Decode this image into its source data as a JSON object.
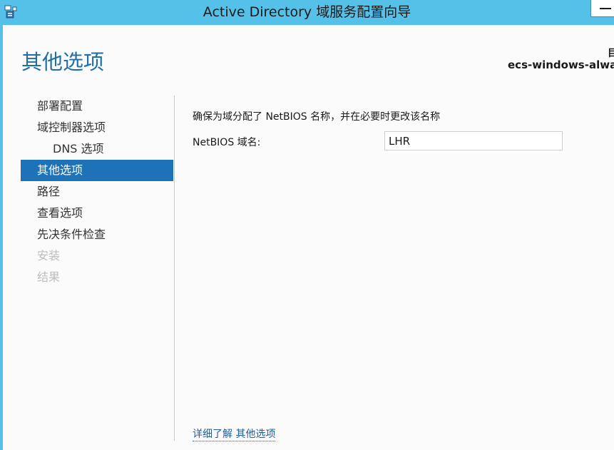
{
  "window": {
    "title": "Active Directory 域服务配置向导",
    "icon": "server-manager-icon"
  },
  "header": {
    "page_title": "其他选项",
    "target_server_label": "目",
    "target_server_name": "ecs-windows-always"
  },
  "nav": {
    "items": [
      {
        "label": "部署配置",
        "state": "normal"
      },
      {
        "label": "域控制器选项",
        "state": "normal"
      },
      {
        "label": "DNS 选项",
        "state": "sub"
      },
      {
        "label": "其他选项",
        "state": "active"
      },
      {
        "label": "路径",
        "state": "normal"
      },
      {
        "label": "查看选项",
        "state": "normal"
      },
      {
        "label": "先决条件检查",
        "state": "normal"
      },
      {
        "label": "安装",
        "state": "disabled"
      },
      {
        "label": "结果",
        "state": "disabled"
      }
    ]
  },
  "main": {
    "prompt": "确保为域分配了 NetBIOS 名称，并在必要时更改该名称",
    "netbios_label": "NetBIOS 域名:",
    "netbios_value": "LHR",
    "more_link_prefix": "详细了解",
    "more_link_topic": "其他选项"
  },
  "colors": {
    "titlebar": "#56c1e8",
    "accent": "#1e73b8",
    "page_title": "#1f6fa6"
  }
}
